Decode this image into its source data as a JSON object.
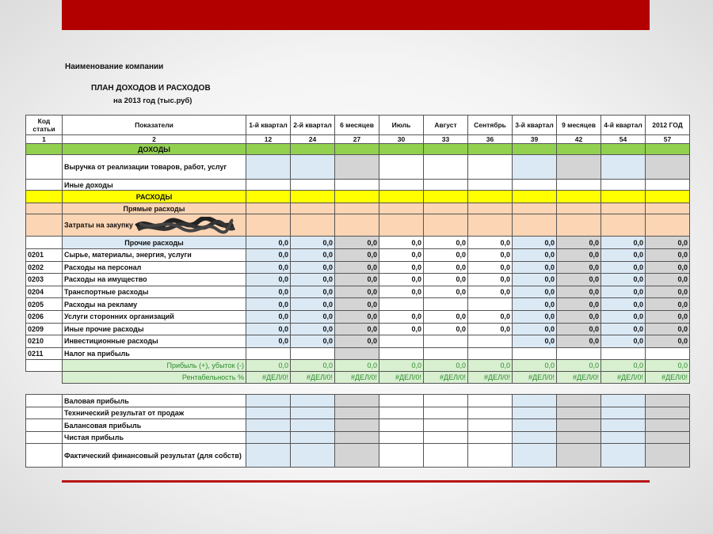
{
  "header": {
    "company": "Наименование компании",
    "plan_title": "ПЛАН ДОХОДОВ И РАСХОДОВ",
    "plan_subtitle": "на 2013 год (тыс.руб)"
  },
  "table": {
    "col_code": "Код статьи",
    "col_indicator": "Показатели",
    "periods": [
      "1-й квартал",
      "2-й квартал",
      "6 месяцев",
      "Июль",
      "Август",
      "Сентябрь",
      "3-й квартал",
      "9 месяцев",
      "4-й квартал",
      "2012 ГОД"
    ],
    "numbering": [
      "1",
      "2",
      "12",
      "24",
      "27",
      "30",
      "33",
      "36",
      "39",
      "42",
      "54",
      "57"
    ],
    "section_income": "ДОХОДЫ",
    "income_rows": [
      "Выручка от реализации товаров, работ, услуг",
      "Иные доходы"
    ],
    "section_expenses": "РАСХОДЫ",
    "direct_expenses": "Прямые расходы",
    "purchase_costs": "Затраты на закупку",
    "other_expenses": {
      "label": "Прочие расходы",
      "values": [
        "0,0",
        "0,0",
        "0,0",
        "0,0",
        "0,0",
        "0,0",
        "0,0",
        "0,0",
        "0,0",
        "0,0"
      ]
    },
    "expense_rows": [
      {
        "code": "0201",
        "label": "Сырье, материалы, энергия, услуги",
        "values": [
          "0,0",
          "0,0",
          "0,0",
          "0,0",
          "0,0",
          "0,0",
          "0,0",
          "0,0",
          "0,0",
          "0,0"
        ]
      },
      {
        "code": "0202",
        "label": "Расходы на персонал",
        "values": [
          "0,0",
          "0,0",
          "0,0",
          "0,0",
          "0,0",
          "0,0",
          "0,0",
          "0,0",
          "0,0",
          "0,0"
        ]
      },
      {
        "code": "0203",
        "label": "Расходы на имущество",
        "values": [
          "0,0",
          "0,0",
          "0,0",
          "0,0",
          "0,0",
          "0,0",
          "0,0",
          "0,0",
          "0,0",
          "0,0"
        ]
      },
      {
        "code": "0204",
        "label": "Транспортные расходы",
        "values": [
          "0,0",
          "0,0",
          "0,0",
          "0,0",
          "0,0",
          "0,0",
          "0,0",
          "0,0",
          "0,0",
          "0,0"
        ]
      },
      {
        "code": "0205",
        "label": "Расходы на рекламу",
        "values": [
          "0,0",
          "0,0",
          "0,0",
          "",
          "",
          "",
          "0,0",
          "0,0",
          "0,0",
          "0,0"
        ]
      },
      {
        "code": "0206",
        "label": "Услуги сторонних организаций",
        "values": [
          "0,0",
          "0,0",
          "0,0",
          "0,0",
          "0,0",
          "0,0",
          "0,0",
          "0,0",
          "0,0",
          "0,0"
        ]
      },
      {
        "code": "0209",
        "label": "Иные прочие расходы",
        "values": [
          "0,0",
          "0,0",
          "0,0",
          "0,0",
          "0,0",
          "0,0",
          "0,0",
          "0,0",
          "0,0",
          "0,0"
        ]
      },
      {
        "code": "0210",
        "label": "Инвестиционные расходы",
        "values": [
          "0,0",
          "0,0",
          "0,0",
          "",
          "",
          "",
          "0,0",
          "0,0",
          "0,0",
          "0,0"
        ]
      },
      {
        "code": "0211",
        "label": "Налог на прибыль",
        "values": [
          "",
          "",
          "",
          "",
          "",
          "",
          "",
          "",
          "",
          ""
        ]
      }
    ],
    "profit_row": {
      "label": "Прибыль (+), убыток (-)",
      "values": [
        "0,0",
        "0,0",
        "0,0",
        "0,0",
        "0,0",
        "0,0",
        "0,0",
        "0,0",
        "0,0",
        "0,0"
      ]
    },
    "profitability_row": {
      "label": "Рентабельность %",
      "values": [
        "#ДЕЛ/0!",
        "#ДЕЛ/0!",
        "#ДЕЛ/0!",
        "#ДЕЛ/0!",
        "#ДЕЛ/0!",
        "#ДЕЛ/0!",
        "#ДЕЛ/0!",
        "#ДЕЛ/0!",
        "#ДЕЛ/0!",
        "#ДЕЛ/0!"
      ]
    },
    "summary_rows": [
      "Валовая прибыль",
      "Технический результат от продаж",
      "Балансовая прибыль",
      "Чистая прибыль",
      "Фактический финансовый результат (для собств)"
    ]
  },
  "colors": {
    "accent_red": "#b20000",
    "income_green": "#92d050",
    "expenses_yellow": "#ffff00",
    "direct_peach": "#fcd5b4",
    "cell_blue": "#dbe9f5",
    "cell_gray": "#d4d4d4"
  }
}
